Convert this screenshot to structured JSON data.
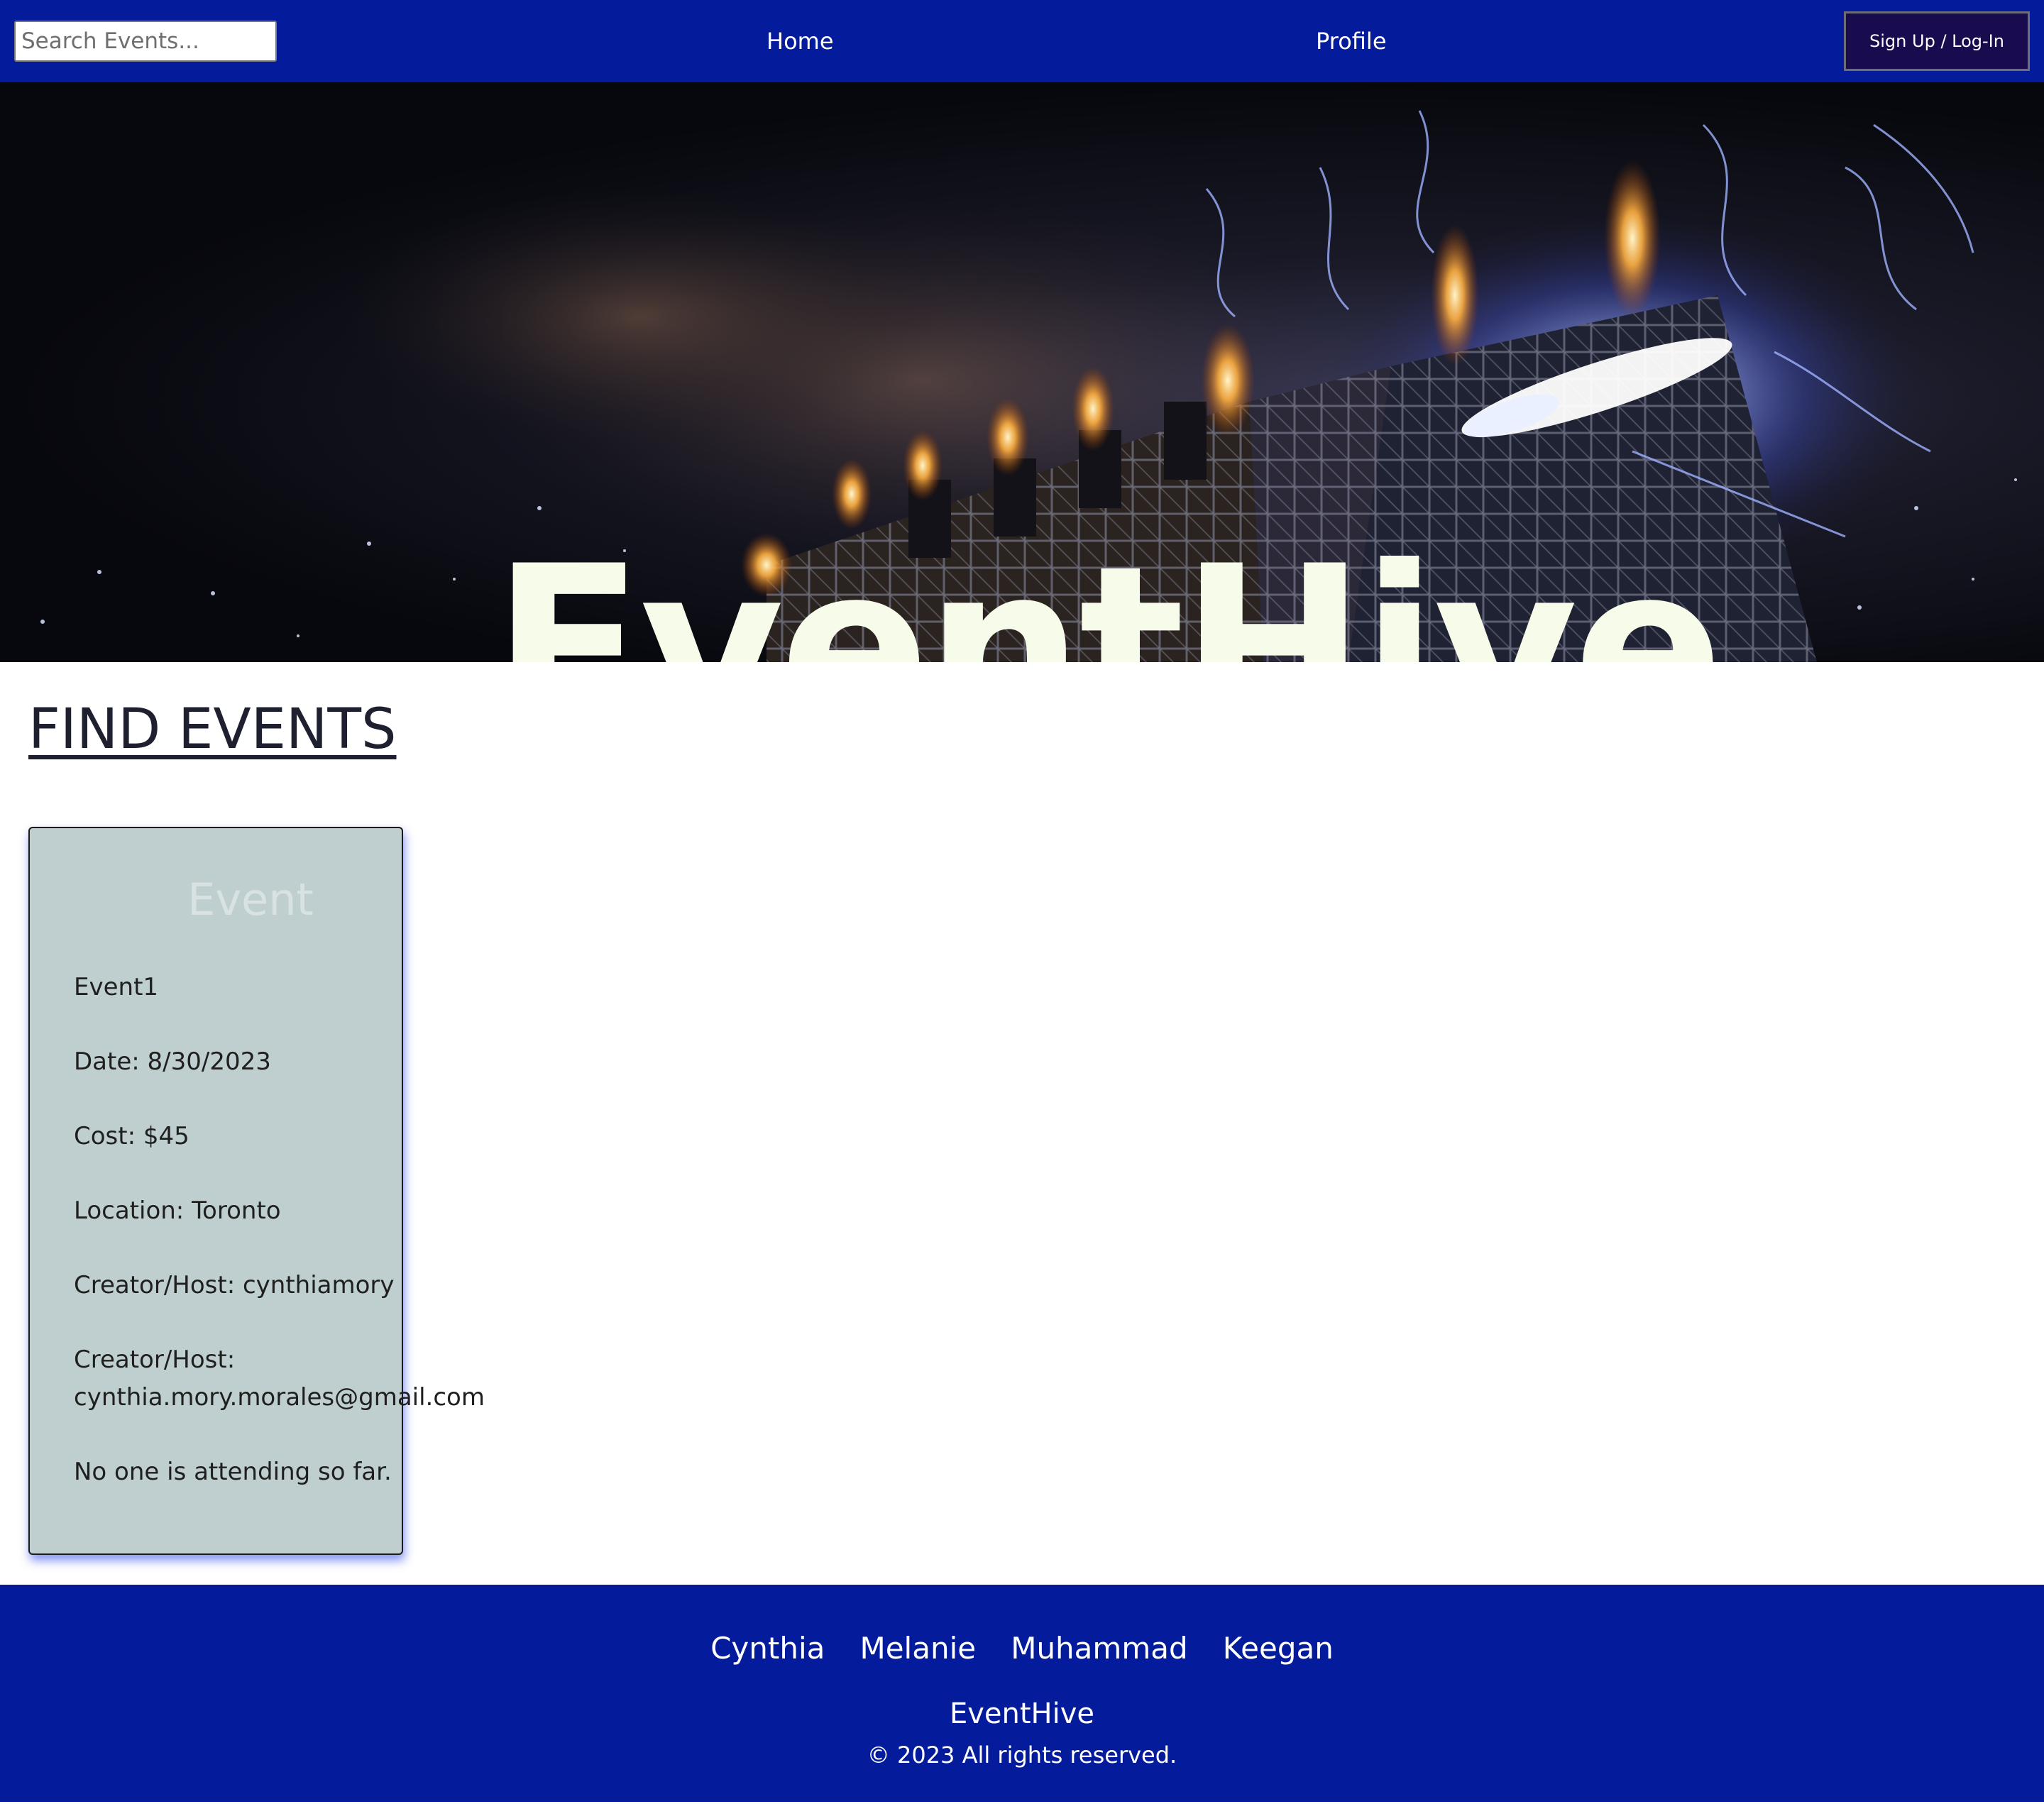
{
  "nav": {
    "search_placeholder": "Search Events...",
    "home_label": "Home",
    "profile_label": "Profile",
    "signup_label": "Sign Up / Log-In"
  },
  "hero": {
    "title": "EventHive"
  },
  "main": {
    "section_title": "FIND EVENTS",
    "event_card": {
      "heading": "Event",
      "name": "Event1",
      "date": "Date: 8/30/2023",
      "cost": "Cost: $45",
      "location": "Location: Toronto",
      "creator": "Creator/Host: cynthiamory",
      "creator_email_label": "Creator/Host:",
      "creator_email": "cynthia.mory.morales@gmail.com",
      "attendance": "No one is attending so far."
    }
  },
  "footer": {
    "names": [
      "Cynthia",
      "Melanie",
      "Muhammad",
      "Keegan"
    ],
    "brand": "EventHive",
    "copyright": "© 2023 All rights reserved."
  },
  "colors": {
    "nav_background": "#041c9c",
    "signup_button": "#180b4e",
    "card_background": "#bfcfcf",
    "card_shadow": "#1e3ce6"
  }
}
